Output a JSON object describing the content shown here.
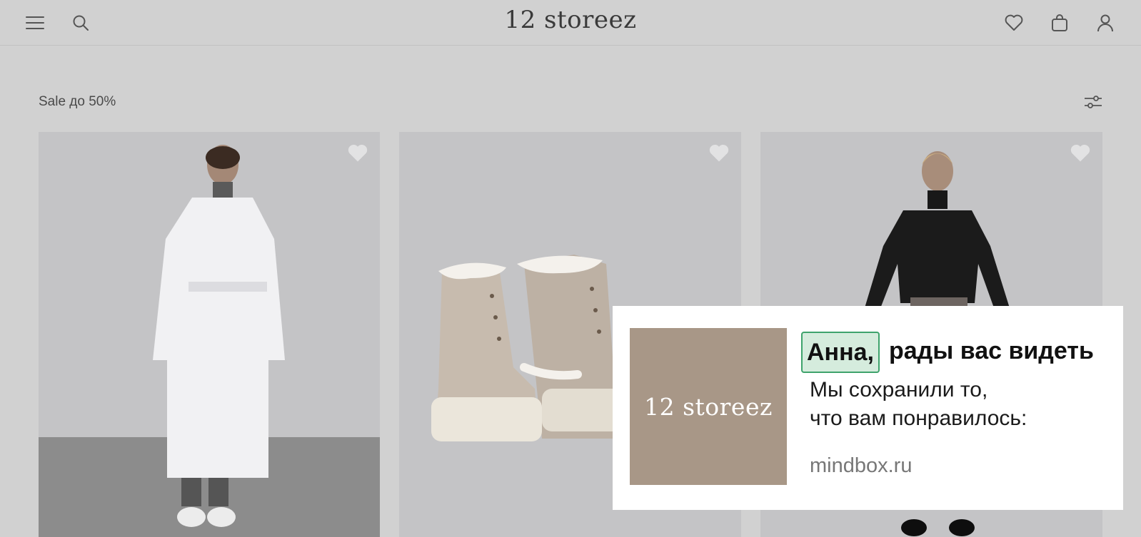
{
  "header": {
    "logo": "12 storeez",
    "icons": [
      "menu-icon",
      "search-icon",
      "heart-icon",
      "bag-icon",
      "user-icon"
    ]
  },
  "section": {
    "title": "Sale до 50%"
  },
  "products": [
    {
      "image": "woman in white belted long coat"
    },
    {
      "image": "beige suede lace-up boots with shearling trim"
    },
    {
      "image": "woman in black sheer turtleneck top"
    }
  ],
  "popup": {
    "name": "Анна,",
    "greeting_rest": "рады вас видеть",
    "line1": "Мы сохранили то,",
    "line2": "что вам понравилось:",
    "domain": "mindbox.ru",
    "logo_text": "12 storeez",
    "colors": {
      "logo_bg": "#a89787",
      "highlight_border": "#3ea36c",
      "highlight_bg": "#d5ecdd"
    }
  }
}
